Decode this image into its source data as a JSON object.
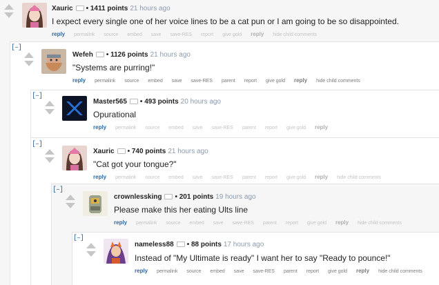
{
  "colors": {
    "link": "#336699",
    "time": "#8a9bb0",
    "background": "#f6f6f6"
  },
  "comments": [
    {
      "collapse": "[–]",
      "author": "Xauric",
      "points": "• 1411 points",
      "time": "21 hours ago",
      "body": "I expect every single one of her voice lines to be a cat pun or I am going to be so disappointed.",
      "avatar_icon": "dva-avatar-icon",
      "actions": [
        "reply",
        "permalink",
        "source",
        "embed",
        "save",
        "save-RES",
        "report",
        "give gold",
        "reply",
        "hide child comments"
      ]
    },
    {
      "collapse": "[–]",
      "author": "Wefeh",
      "points": "• 1126 points",
      "time": "21 hours ago",
      "body": "\"Systems are purring!\"",
      "avatar_icon": "torbjorn-avatar-icon",
      "actions": [
        "reply",
        "permalink",
        "source",
        "embed",
        "save",
        "save-RES",
        "parent",
        "report",
        "give gold",
        "reply",
        "hide child comments"
      ]
    },
    {
      "collapse": "[–]",
      "author": "Master565",
      "points": "• 493 points",
      "time": "20 hours ago",
      "body": "Opurational",
      "avatar_icon": "team-logo-icon",
      "actions": [
        "reply",
        "permalink",
        "source",
        "embed",
        "save",
        "save-RES",
        "parent",
        "report",
        "give gold",
        "reply"
      ]
    },
    {
      "collapse": "[–]",
      "author": "Xauric",
      "points": "• 740 points",
      "time": "21 hours ago",
      "body": "\"Cat got your tongue?\"",
      "avatar_icon": "dva-avatar-icon",
      "actions": [
        "reply",
        "permalink",
        "source",
        "embed",
        "save",
        "save-RES",
        "parent",
        "report",
        "give gold",
        "reply",
        "hide child comments"
      ]
    },
    {
      "collapse": "[–]",
      "author": "crownlessking",
      "points": "• 201 points",
      "time": "19 hours ago",
      "body": "Please make this her eating Ults line",
      "avatar_icon": "bastion-avatar-icon",
      "actions": [
        "reply",
        "permalink",
        "source",
        "embed",
        "save",
        "save-RES",
        "parent",
        "report",
        "give gold",
        "reply",
        "hide child comments"
      ]
    },
    {
      "collapse": "[–]",
      "author": "nameless88",
      "points": "• 88 points",
      "time": "17 hours ago",
      "body": "Instead of \"My Ultimate is ready\" I want her to say \"Ready to pounce!\"",
      "avatar_icon": "character-avatar-icon",
      "actions": [
        "reply",
        "permalink",
        "source",
        "embed",
        "save",
        "save-RES",
        "parent",
        "report",
        "give gold",
        "reply",
        "hide child comments"
      ]
    }
  ]
}
